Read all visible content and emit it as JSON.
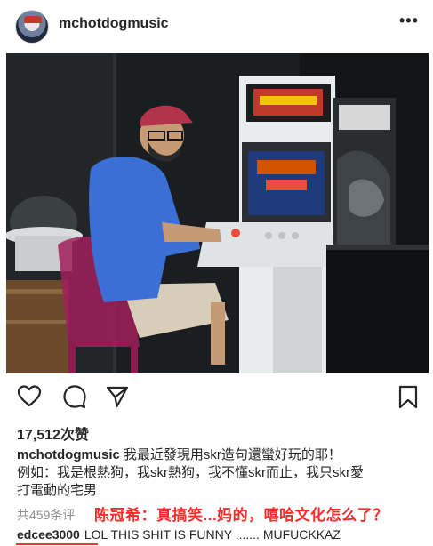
{
  "post": {
    "username": "mchotdogmusic",
    "more_icon": "more-options-icon",
    "more_glyph": "•••"
  },
  "actions": {
    "like_icon": "heart-icon",
    "comment_icon": "comment-icon",
    "share_icon": "share-icon",
    "save_icon": "bookmark-icon"
  },
  "likes": "17,512次赞",
  "caption": {
    "username": "mchotdogmusic",
    "line1": "我最近發現用skr造句還蠻好玩的耶！",
    "line2": "例如：我是根熱狗，我skr熱狗，我不懂skr而止，我只skr愛",
    "line3": "打電動的宅男"
  },
  "comments_count": "共459条评",
  "overlay_text": "陈冠希：真搞笑...妈的，嘻哈文化怎么了？",
  "comment": {
    "username": "edcee3000",
    "text": "LOL THIS SHIT IS FUNNY ....... MUFUCKKAZ"
  },
  "colors": {
    "text": "#262626",
    "muted": "#8e8e8e",
    "overlay_red": "#ff2a2a"
  }
}
